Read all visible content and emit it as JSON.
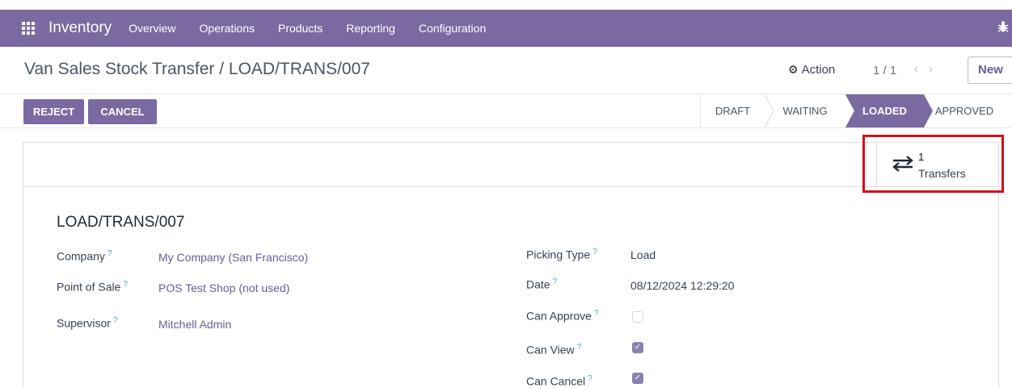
{
  "navbar": {
    "apps_icon": "apps-grid-icon",
    "brand": "Inventory",
    "menu": [
      "Overview",
      "Operations",
      "Products",
      "Reporting",
      "Configuration"
    ],
    "bug_icon": "bug-icon"
  },
  "breadcrumb": {
    "title": "Van Sales Stock Transfer / LOAD/TRANS/007"
  },
  "control_panel": {
    "action_label": "Action",
    "pager": "1 / 1",
    "new_label": "New"
  },
  "header_buttons": {
    "reject": "REJECT",
    "cancel": "CANCEL"
  },
  "statusbar": {
    "stages": [
      "DRAFT",
      "WAITING",
      "LOADED",
      "APPROVED"
    ],
    "active": "LOADED",
    "active_color": "#7a6aa1"
  },
  "smart_button": {
    "count": "1",
    "label": "Transfers",
    "icon": "transfers-arrows-icon"
  },
  "record": {
    "name": "LOAD/TRANS/007",
    "left_fields": [
      {
        "label": "Company",
        "value": "My Company (San Francisco)"
      },
      {
        "label": "Point of Sale",
        "value": "POS Test Shop (not used)"
      },
      {
        "label": "Supervisor",
        "value": "Mitchell Admin"
      }
    ],
    "right_fields": [
      {
        "label": "Picking Type",
        "value": "Load"
      },
      {
        "label": "Date",
        "value": "08/12/2024 12:29:20"
      },
      {
        "label": "Can Approve",
        "checked": false
      },
      {
        "label": "Can View",
        "checked": true
      },
      {
        "label": "Can Cancel",
        "checked": true
      }
    ],
    "help_marker": "?"
  },
  "colors": {
    "brand": "#7a6aa1",
    "highlight": "#d0101a",
    "link": "#6a5c92"
  }
}
